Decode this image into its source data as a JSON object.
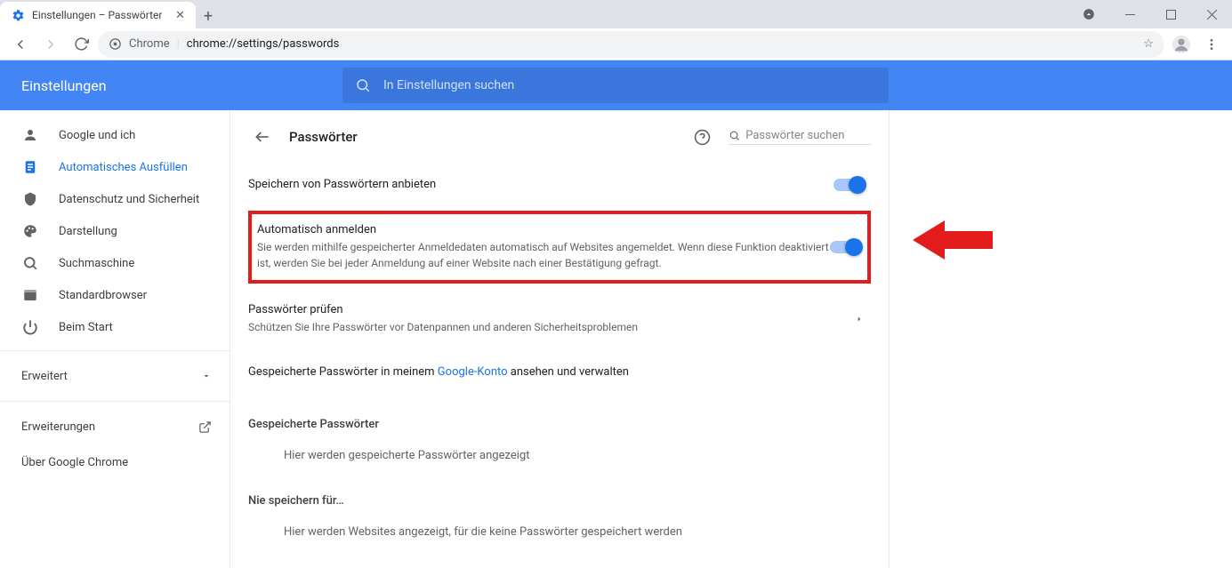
{
  "browser": {
    "tab_title": "Einstellungen – Passwörter",
    "url_prefix": "Chrome",
    "url_path": "chrome://settings/passwords"
  },
  "header": {
    "app_title": "Einstellungen",
    "search_placeholder": "In Einstellungen suchen"
  },
  "sidebar": {
    "items": [
      {
        "label": "Google und ich"
      },
      {
        "label": "Automatisches Ausfüllen"
      },
      {
        "label": "Datenschutz und Sicherheit"
      },
      {
        "label": "Darstellung"
      },
      {
        "label": "Suchmaschine"
      },
      {
        "label": "Standardbrowser"
      },
      {
        "label": "Beim Start"
      }
    ],
    "advanced": "Erweitert",
    "extensions": "Erweiterungen",
    "about": "Über Google Chrome"
  },
  "page": {
    "title": "Passwörter",
    "search_placeholder": "Passwörter suchen",
    "offer_save": "Speichern von Passwörtern anbieten",
    "auto_signin_title": "Automatisch anmelden",
    "auto_signin_desc": "Sie werden mithilfe gespeicherter Anmeldedaten automatisch auf Websites angemeldet. Wenn diese Funktion deaktiviert ist, werden Sie bei jeder Anmeldung auf einer Website nach einer Bestätigung gefragt.",
    "check_title": "Passwörter prüfen",
    "check_desc": "Schützen Sie Ihre Passwörter vor Datenpannen und anderen Sicherheitsproblemen",
    "saved_link_pre": "Gespeicherte Passwörter in meinem ",
    "saved_link_link": "Google-Konto",
    "saved_link_post": " ansehen und verwalten",
    "saved_title": "Gespeicherte Passwörter",
    "saved_empty": "Hier werden gespeicherte Passwörter angezeigt",
    "never_title": "Nie speichern für…",
    "never_empty": "Hier werden Websites angezeigt, für die keine Passwörter gespeichert werden"
  }
}
